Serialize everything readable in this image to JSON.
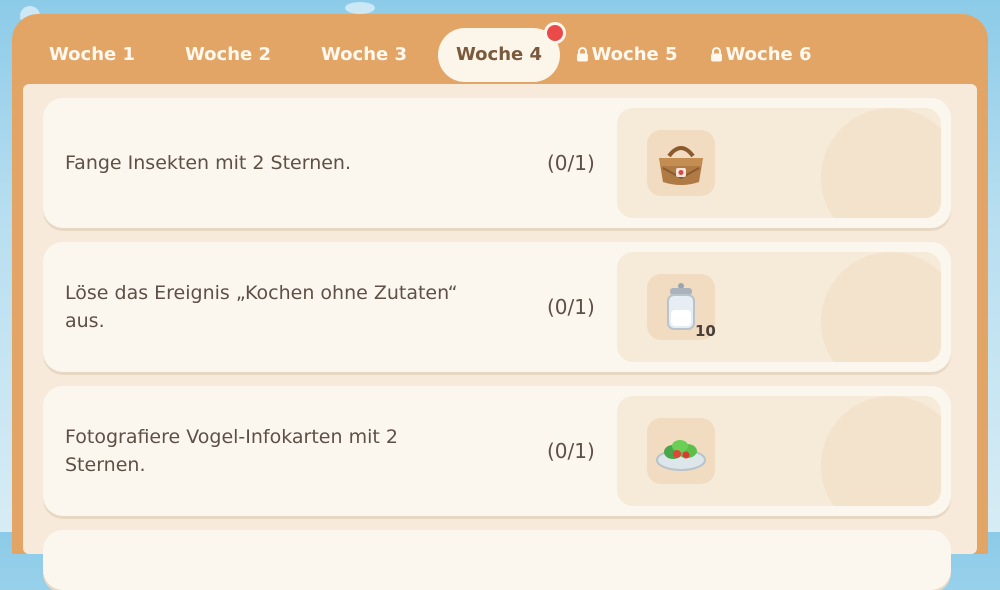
{
  "tabs": [
    {
      "label": "Woche 1",
      "locked": false,
      "active": false
    },
    {
      "label": "Woche 2",
      "locked": false,
      "active": false
    },
    {
      "label": "Woche 3",
      "locked": false,
      "active": false
    },
    {
      "label": "Woche 4",
      "locked": false,
      "active": true,
      "notification": true
    },
    {
      "label": "Woche 5",
      "locked": true,
      "active": false
    },
    {
      "label": "Woche 6",
      "locked": true,
      "active": false
    }
  ],
  "tasks": [
    {
      "description": "Fange Insekten mit 2 Sternen.",
      "progress": "(0/1)",
      "reward_icon": "picnic-basket-icon",
      "reward_qty": ""
    },
    {
      "description": "Löse das Ereignis „Kochen ohne Zutaten“ aus.",
      "progress": "(0/1)",
      "reward_icon": "glass-jar-icon",
      "reward_qty": "10"
    },
    {
      "description": "Fotografiere Vogel-Infokarten mit 2 Sternen.",
      "progress": "(0/1)",
      "reward_icon": "salad-plate-icon",
      "reward_qty": ""
    }
  ],
  "colors": {
    "panel": "#e2a566",
    "active_tab_bg": "#fbf5ea",
    "notification": "#ea4a4a",
    "card_bg": "#fbf7ef"
  }
}
